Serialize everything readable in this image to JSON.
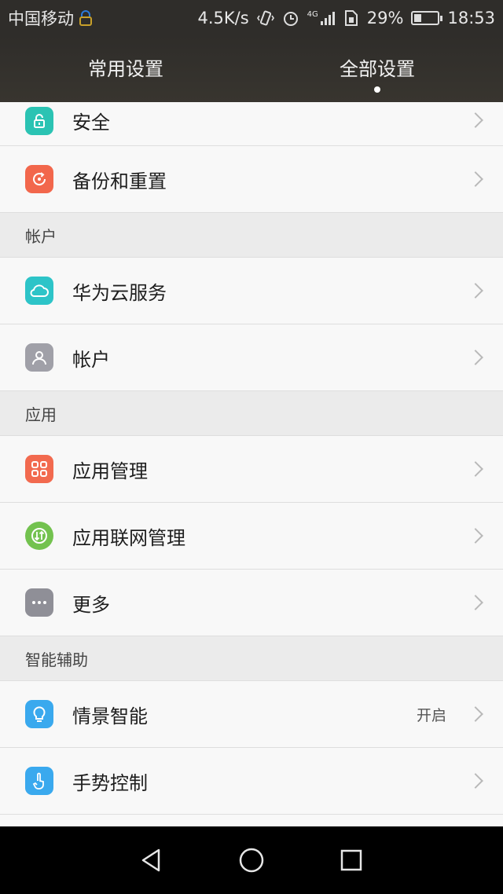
{
  "status": {
    "carrier": "中国移动",
    "speed": "4.5K/s",
    "network": "4G",
    "battery": "29%",
    "battery_level": 0.29,
    "time": "18:53"
  },
  "tabs": [
    {
      "label": "常用设置",
      "active": false
    },
    {
      "label": "全部设置",
      "active": true
    }
  ],
  "list": {
    "security": {
      "label": "安全",
      "icon": "lock-icon",
      "color": "#2bc3b3"
    },
    "backup": {
      "label": "备份和重置",
      "icon": "backup-icon",
      "color": "#f2674c"
    },
    "section_account": "帐户",
    "cloud": {
      "label": "华为云服务",
      "icon": "cloud-icon",
      "color": "#2dc4c8"
    },
    "account": {
      "label": "帐户",
      "icon": "person-icon",
      "color": "#a0a0a8"
    },
    "section_apps": "应用",
    "app_manage": {
      "label": "应用管理",
      "icon": "grid-icon",
      "color": "#f26a4f"
    },
    "app_network": {
      "label": "应用联网管理",
      "icon": "data-transfer-icon",
      "color": "#73c24f"
    },
    "more": {
      "label": "更多",
      "icon": "more-icon",
      "color": "#8f8f97"
    },
    "section_smart": "智能辅助",
    "scene": {
      "label": "情景智能",
      "value": "开启",
      "icon": "bulb-icon",
      "color": "#3aa9ee"
    },
    "gesture": {
      "label": "手势控制",
      "icon": "hand-icon",
      "color": "#3aa9ee"
    }
  }
}
